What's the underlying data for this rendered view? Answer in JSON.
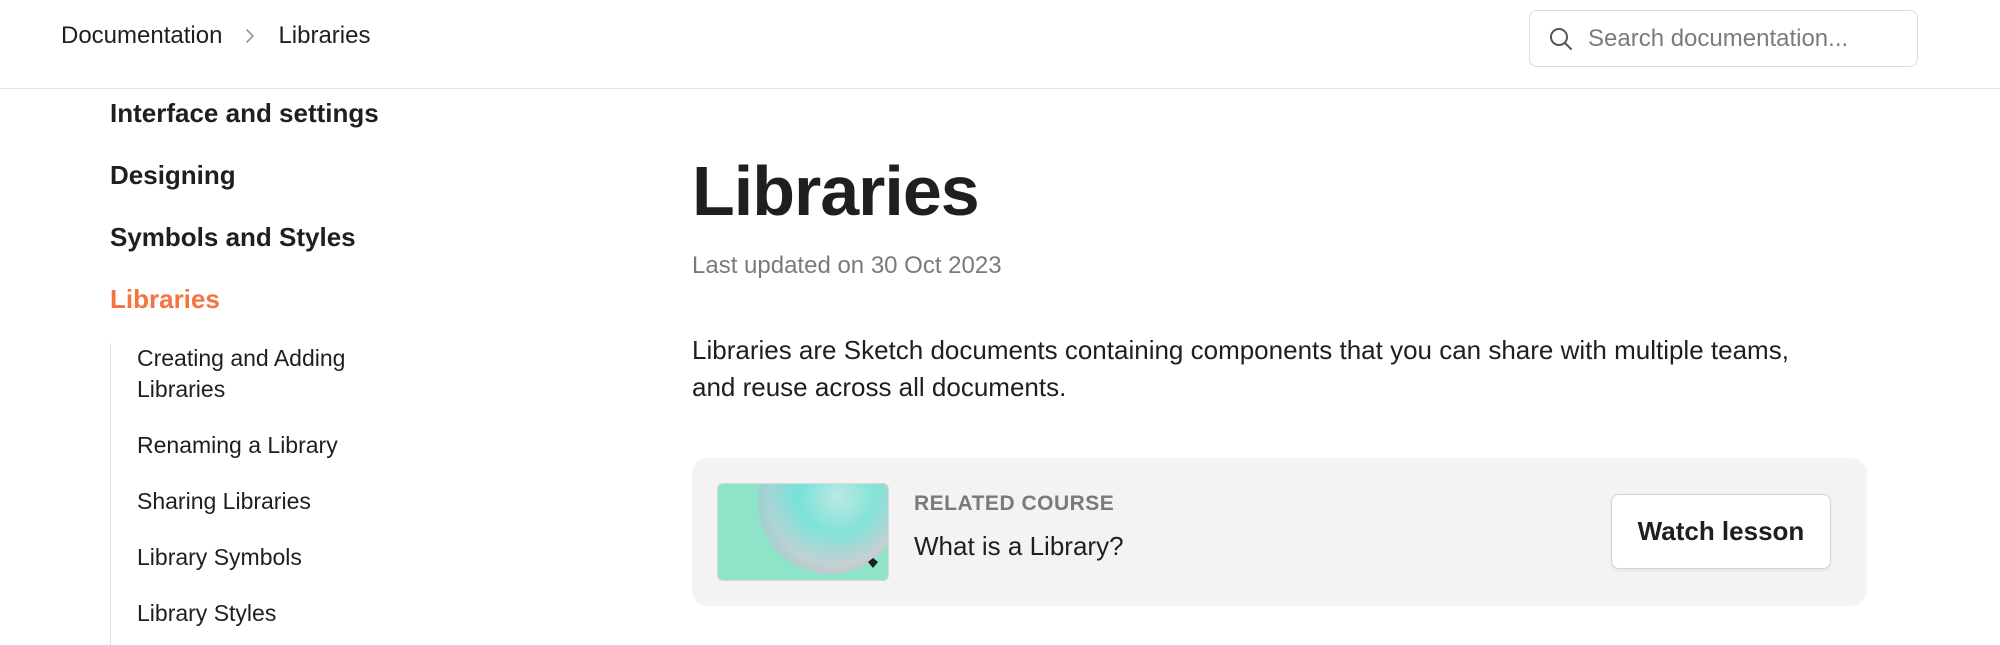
{
  "header": {
    "breadcrumb": {
      "root": "Documentation",
      "current": "Libraries"
    },
    "search": {
      "placeholder": "Search documentation..."
    }
  },
  "sidebar": {
    "sections": [
      {
        "label": "Interface and settings",
        "active": false
      },
      {
        "label": "Designing",
        "active": false
      },
      {
        "label": "Symbols and Styles",
        "active": false
      },
      {
        "label": "Libraries",
        "active": true
      }
    ],
    "sub_items": [
      {
        "label": "Creating and Adding Libraries"
      },
      {
        "label": "Renaming a Library"
      },
      {
        "label": "Sharing Libraries"
      },
      {
        "label": "Library Symbols"
      },
      {
        "label": "Library Styles"
      }
    ]
  },
  "main": {
    "title": "Libraries",
    "updated": "Last updated on 30 Oct 2023",
    "intro": "Libraries are Sketch documents containing components that you can share with multiple teams, and reuse across all documents.",
    "related_course": {
      "label": "RELATED COURSE",
      "title": "What is a Library?",
      "button": "Watch lesson"
    }
  },
  "colors": {
    "accent": "#f2753f",
    "text": "#1f1f1f",
    "muted": "#7a7a7a",
    "card_bg": "#f3f3f3",
    "thumb_bg": "#8ee3c8"
  }
}
